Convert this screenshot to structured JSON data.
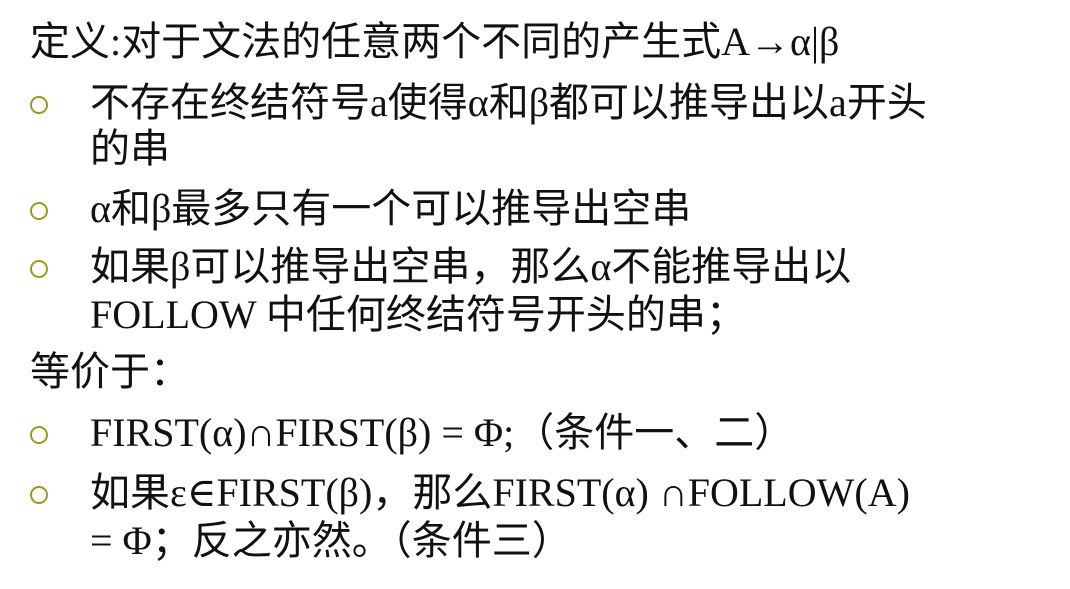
{
  "slide": {
    "definition_heading": "定义:对于文法的任意两个不同的产生式A→α|β",
    "condition_bullets": [
      {
        "lines": [
          "不存在终结符号a使得α和β都可以推导出以a开头",
          "的串"
        ]
      },
      {
        "lines": [
          "α和β最多只有一个可以推导出空串"
        ]
      },
      {
        "lines": [
          "如果β可以推导出空串，那么α不能推导出以",
          "FOLLOW 中任何终结符号开头的串；"
        ]
      }
    ],
    "equivalent_heading": "等价于：",
    "equivalent_bullets": [
      {
        "lines": [
          "FIRST(α)∩FIRST(β) = Φ;（条件一、二）"
        ]
      },
      {
        "lines": [
          "如果ε∈FIRST(β)，那么FIRST(α) ∩FOLLOW(A)",
          "= Φ；反之亦然。（条件三）"
        ]
      }
    ],
    "colors": {
      "text": "#111111",
      "bullet": "#9a9a1e",
      "background": "#ffffff"
    }
  }
}
